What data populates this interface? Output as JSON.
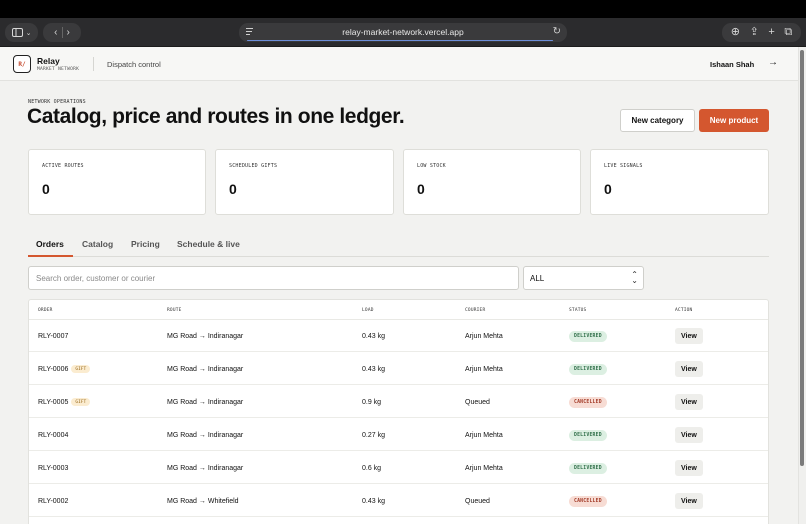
{
  "browser": {
    "url": "relay-market-network.vercel.app"
  },
  "header": {
    "logo_mark": "R/",
    "brand_name": "Relay",
    "brand_sub": "MARKET NETWORK",
    "section": "Dispatch control",
    "user_name": "Ishaan Shah"
  },
  "page": {
    "eyebrow": "NETWORK OPERATIONS",
    "title": "Catalog, price and routes in one ledger.",
    "new_category_label": "New category",
    "new_product_label": "New product"
  },
  "stats": [
    {
      "label": "ACTIVE ROUTES",
      "value": "0"
    },
    {
      "label": "SCHEDULED GIFTS",
      "value": "0"
    },
    {
      "label": "LOW STOCK",
      "value": "0"
    },
    {
      "label": "LIVE SIGNALS",
      "value": "0"
    }
  ],
  "tabs": [
    {
      "label": "Orders",
      "active": true
    },
    {
      "label": "Catalog",
      "active": false
    },
    {
      "label": "Pricing",
      "active": false
    },
    {
      "label": "Schedule & live",
      "active": false
    }
  ],
  "filters": {
    "search_placeholder": "Search order, customer or courier",
    "status_value": "ALL"
  },
  "table": {
    "headers": [
      "ORDER",
      "ROUTE",
      "LOAD",
      "COURIER",
      "STATUS",
      "ACTION"
    ],
    "gift_badge": "GIFT",
    "rows": [
      {
        "order": "RLY-0007",
        "gift": false,
        "route": "MG Road → Indiranagar",
        "load": "0.43 kg",
        "courier": "Arjun Mehta",
        "status": "DELIVERED",
        "action": "View"
      },
      {
        "order": "RLY-0006",
        "gift": true,
        "route": "MG Road → Indiranagar",
        "load": "0.43 kg",
        "courier": "Arjun Mehta",
        "status": "DELIVERED",
        "action": "View"
      },
      {
        "order": "RLY-0005",
        "gift": true,
        "route": "MG Road → Indiranagar",
        "load": "0.9 kg",
        "courier": "Queued",
        "status": "CANCELLED",
        "action": "View"
      },
      {
        "order": "RLY-0004",
        "gift": false,
        "route": "MG Road → Indiranagar",
        "load": "0.27 kg",
        "courier": "Arjun Mehta",
        "status": "DELIVERED",
        "action": "View"
      },
      {
        "order": "RLY-0003",
        "gift": false,
        "route": "MG Road → Indiranagar",
        "load": "0.6 kg",
        "courier": "Arjun Mehta",
        "status": "DELIVERED",
        "action": "View"
      },
      {
        "order": "RLY-0002",
        "gift": false,
        "route": "MG Road → Whitefield",
        "load": "0.43 kg",
        "courier": "Queued",
        "status": "CANCELLED",
        "action": "View"
      }
    ]
  },
  "colors": {
    "accent": "#d4572f",
    "delivered": "#2f6e48",
    "cancelled": "#a33b28"
  }
}
